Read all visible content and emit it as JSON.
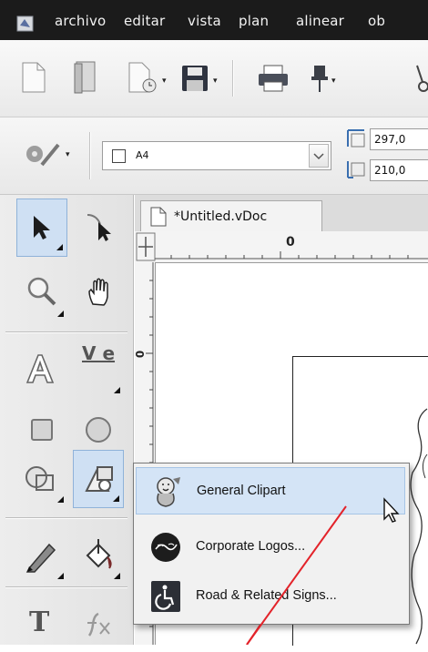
{
  "menubar": {
    "items": [
      "archivo",
      "editar",
      "vista",
      "plan",
      "alinear",
      "ob"
    ]
  },
  "toolbar": {
    "paper_size": "A4",
    "width_value": "297,0",
    "height_value": "210,0"
  },
  "document": {
    "tab_title": "*Untitled.vDoc",
    "ruler_zero_h": "0",
    "ruler_zero_v": "0"
  },
  "tools": {
    "text_tool_letter": "T",
    "vertical_text_letters": "V e"
  },
  "clipart_menu": {
    "items": [
      {
        "label": "General Clipart",
        "highlighted": true,
        "icon": "clipart-character-icon"
      },
      {
        "label": "Corporate Logos...",
        "highlighted": false,
        "icon": "coca-cola-logo-icon"
      },
      {
        "label": "Road & Related Signs...",
        "highlighted": false,
        "icon": "wheelchair-sign-icon"
      }
    ]
  },
  "colors": {
    "menubar_bg": "#1b1b1b",
    "active_tool_bg": "#cfe0f3",
    "menu_highlight": "#d4e4f6",
    "annotation_line": "#e3232a"
  }
}
